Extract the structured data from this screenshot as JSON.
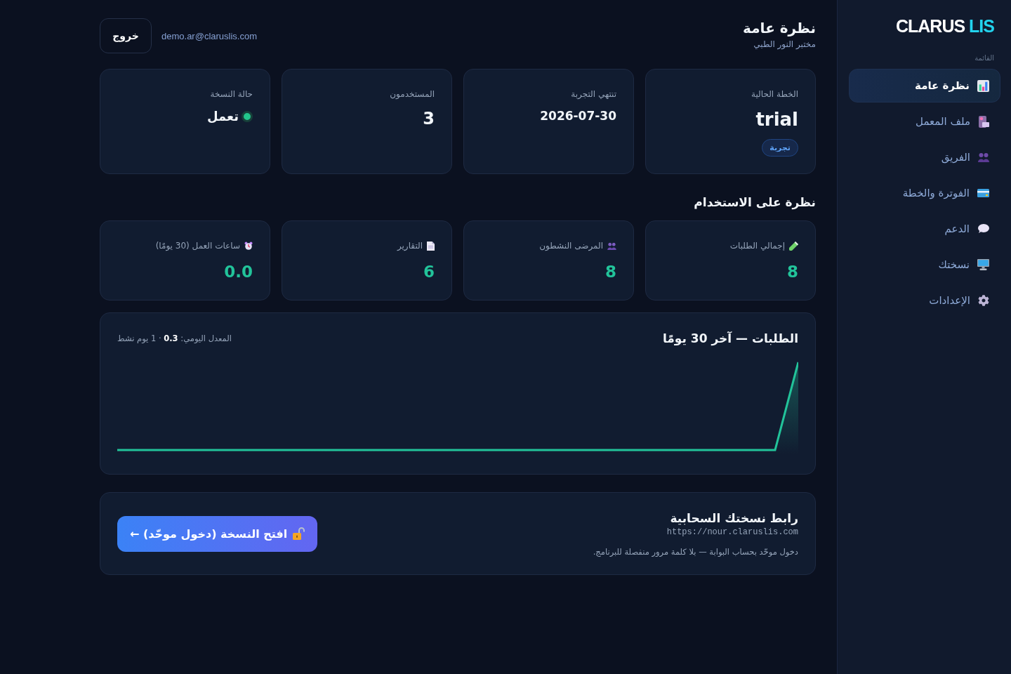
{
  "sidebar": {
    "logo": {
      "name": "CLARUS",
      "suffix": "LIS"
    },
    "section_label": "القائمة",
    "items": [
      {
        "label": "نظرة عامة",
        "selected": true
      },
      {
        "label": "ملف المعمل",
        "selected": false
      },
      {
        "label": "الفريق",
        "selected": false
      },
      {
        "label": "الفوترة والخطة",
        "selected": false
      },
      {
        "label": "الدعم",
        "selected": false
      },
      {
        "label": "نسختك",
        "selected": false
      },
      {
        "label": "الإعدادات",
        "selected": false
      }
    ]
  },
  "header": {
    "title": "نظرة عامة",
    "subtitle": "مختبر النور الطبي",
    "email": "demo.ar@claruslis.com",
    "logout_button": "خروج"
  },
  "summary_cards": [
    {
      "kind": "plan",
      "label": "الخطة الحالية",
      "value": "trial",
      "badge": "تجربة"
    },
    {
      "kind": "date",
      "label": "تنتهي التجربة",
      "value": "2026-07-30"
    },
    {
      "kind": "count",
      "label": "المستخدمون",
      "value": "3"
    },
    {
      "kind": "status",
      "label": "حالة النسخة",
      "value": "تعمل",
      "color": "#22c58b"
    }
  ],
  "usage": {
    "title": "نظرة على الاستخدام",
    "cards": [
      {
        "label": "إجمالي الطلبات",
        "value": "8"
      },
      {
        "label": "المرضى النشطون",
        "value": "8"
      },
      {
        "label": "التقارير",
        "value": "6"
      },
      {
        "label": "ساعات العمل (30 يومًا)",
        "value": "0.0"
      }
    ]
  },
  "requests_chart": {
    "title": "الطلبات — آخر 30 يومًا",
    "summary": "المعدل اليومي: **0.3** · 1 يوم نشط"
  },
  "cloud_link": {
    "title": "رابط نسختك السحابية",
    "url": "https://nour.claruslis.com",
    "note": "دخول موحّد بحساب البوابة — بلا كلمة مرور منفصلة للبرنامج.",
    "button": "افتح النسخة (دخول موحّد) ←"
  }
}
